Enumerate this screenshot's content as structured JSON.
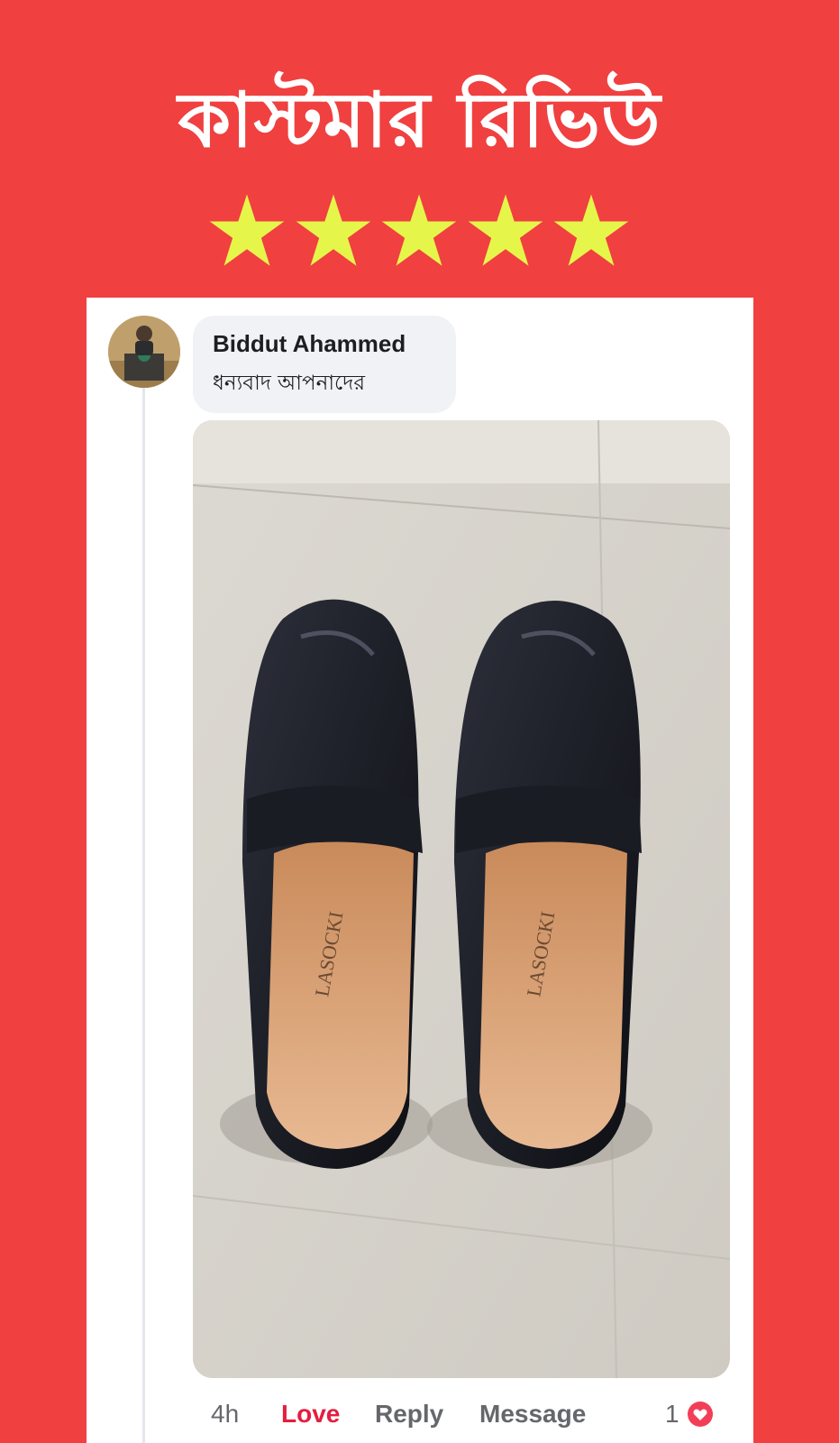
{
  "banner": {
    "title": "কাস্টমার রিভিউ",
    "rating": 5,
    "star_color": "#e6f54a",
    "background_color": "#f04040"
  },
  "comment": {
    "author": "Biddut Ahammed",
    "text": "ধন্যবাদ আপনাদের",
    "avatar_icon": "user-avatar",
    "photo_description_icon": "black-leather-loafers-photo"
  },
  "actions": {
    "time": "4h",
    "love": "Love",
    "reply": "Reply",
    "message": "Message",
    "reaction_count": "1",
    "reaction_icon": "heart-icon",
    "love_color": "#e41e3f"
  }
}
